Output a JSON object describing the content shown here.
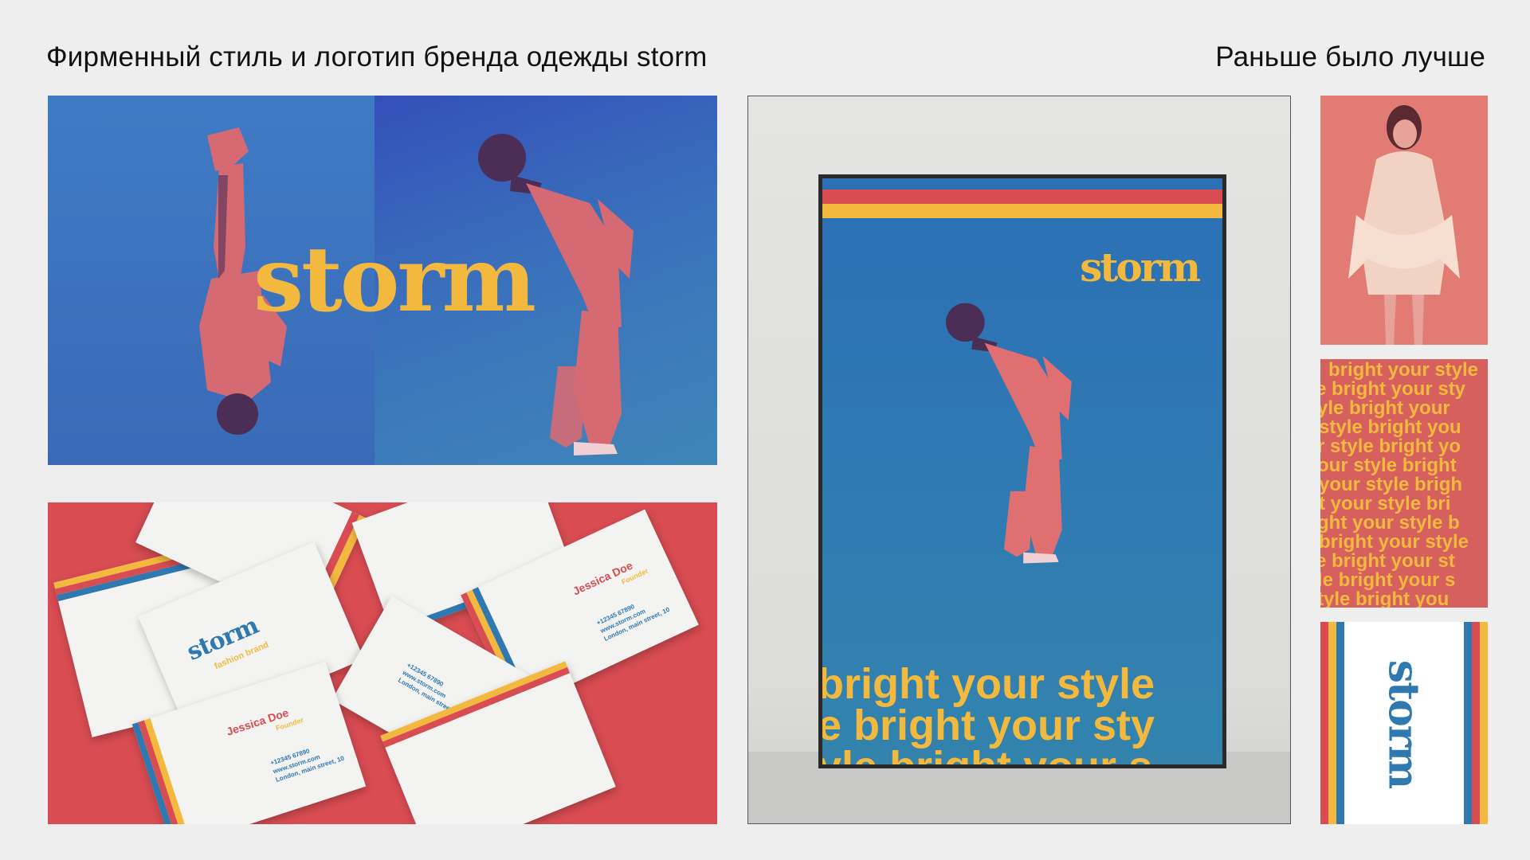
{
  "header": {
    "title": "Фирменный стиль и логотип бренда одежды storm",
    "tagline": "Раньше было лучше"
  },
  "brand": {
    "logo": "storm",
    "slogan": "bright your style",
    "colors": {
      "blue": "#2f78b0",
      "red": "#d84c52",
      "yellow": "#f2b93e",
      "pink": "#e27b74"
    }
  },
  "cards": {
    "name": "Jessica Doe",
    "role": "Founder",
    "phone": "+12345 67890",
    "site": "www.storm.com",
    "address": "London, main street, 10",
    "sub": "fashion brand"
  },
  "poster": {
    "lines": [
      "bright your style",
      "e bright your sty",
      "yle bright your s"
    ]
  },
  "pattern": {
    "lines": [
      "bright your style",
      "e bright your sty",
      "yle bright your",
      "style bright you",
      "r style bright yo",
      "our style bright",
      "your style brigh",
      "t your style bri",
      "ght your style b",
      "bright your style",
      "e bright your st",
      "le bright your s",
      "tyle bright you"
    ]
  }
}
